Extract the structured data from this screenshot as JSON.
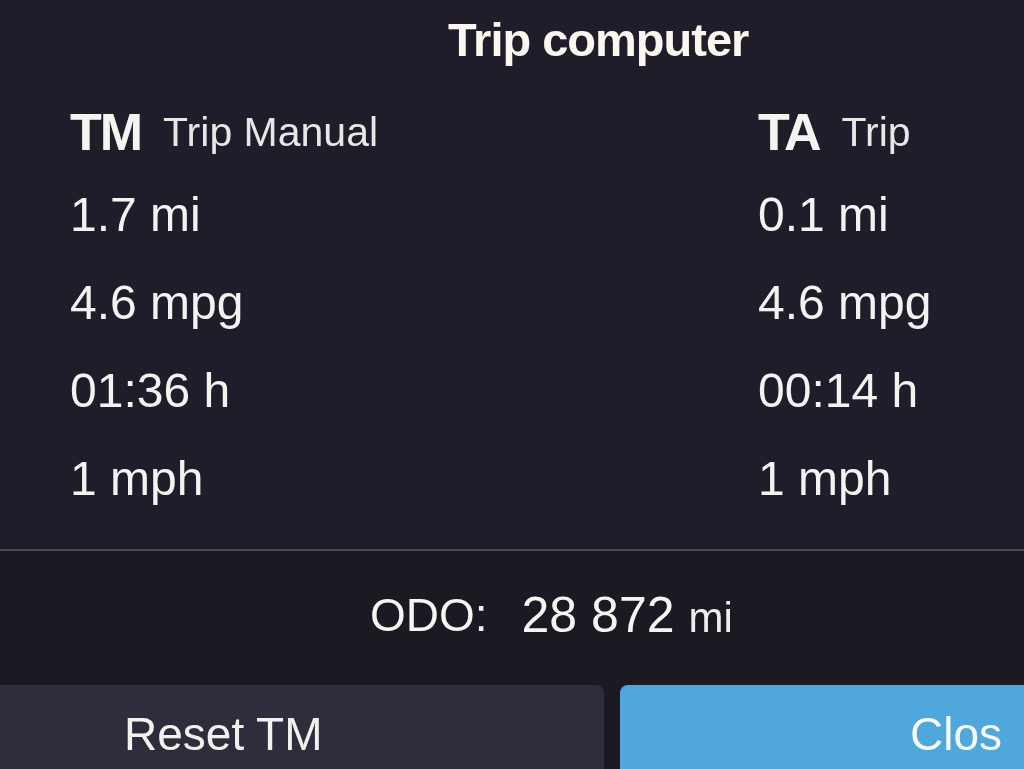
{
  "title": "Trip computer",
  "trips": [
    {
      "code": "TM",
      "name": "Trip Manual",
      "readings": [
        "1.7 mi",
        "4.6 mpg",
        "01:36 h",
        "1 mph"
      ]
    },
    {
      "code": "TA",
      "name": "Trip",
      "readings": [
        "0.1 mi",
        "4.6 mpg",
        "00:14 h",
        "1 mph"
      ]
    }
  ],
  "odometer": {
    "label": "ODO:",
    "value": "28 872",
    "unit": "mi"
  },
  "buttons": [
    {
      "label": "Reset TM",
      "kind": "secondary"
    },
    {
      "label": "Clos",
      "kind": "primary"
    }
  ]
}
